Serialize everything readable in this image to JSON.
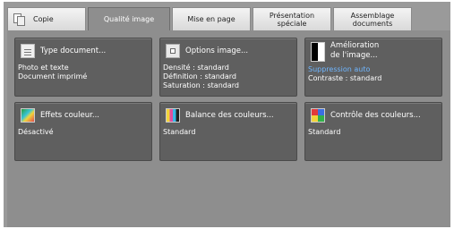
{
  "tabs": [
    {
      "label": "Copie",
      "active": false
    },
    {
      "label": "Qualité image",
      "active": true
    },
    {
      "label": "Mise en page",
      "active": false
    },
    {
      "label": "Présentation spéciale",
      "active": false
    },
    {
      "label": "Assemblage documents",
      "active": false
    }
  ],
  "cards": {
    "type_document": {
      "title": "Type document...",
      "lines": [
        "Photo et texte",
        "Document imprimé"
      ]
    },
    "options_image": {
      "title": "Options image...",
      "lines": [
        "Densité : standard",
        "Définition : standard",
        "Saturation : standard"
      ]
    },
    "amelioration": {
      "title_line1": "Amélioration",
      "title_line2": "de l'image...",
      "lines": [
        "Suppression auto",
        "Contraste : standard"
      ]
    },
    "effets_couleur": {
      "title": "Effets couleur...",
      "lines": [
        "Désactivé"
      ]
    },
    "balance_couleurs": {
      "title": "Balance des couleurs...",
      "lines": [
        "Standard"
      ]
    },
    "controle_couleurs": {
      "title": "Contrôle des couleurs...",
      "lines": [
        "Standard"
      ]
    }
  },
  "icons": {
    "copy": "copy-icon",
    "type_document": "document-icon",
    "options_image": "image-options-icon",
    "amelioration": "image-enhancement-icon",
    "effets_couleur": "color-effects-icon",
    "balance_couleurs": "color-balance-icon",
    "controle_couleurs": "color-control-icon"
  },
  "colors": {
    "active_tab": "#8e8e8e",
    "card_background": "#5f5f5f",
    "highlight_text": "#6fb6ff"
  }
}
